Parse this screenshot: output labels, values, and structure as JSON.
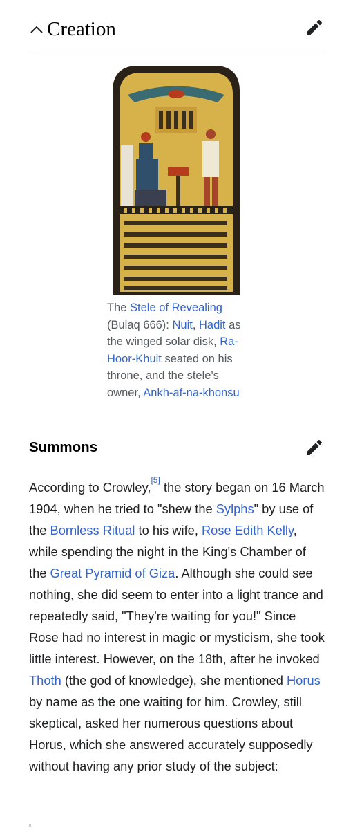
{
  "creation": {
    "title": "Creation",
    "collapse_icon": "chevron-up-icon",
    "edit_icon": "pencil-icon"
  },
  "figure": {
    "image": "stele-of-revealing-image",
    "caption": {
      "p1": "The ",
      "l1": "Stele of Revealing",
      "p2": " (Bulaq 666): ",
      "l2": "Nuit",
      "p3": ", ",
      "l3": "Hadit",
      "p4": " as the winged solar disk, ",
      "l4": "Ra-Hoor-Khuit",
      "p5": " seated on his throne, and the stele's owner, ",
      "l5": "Ankh-af-na-khonsu"
    }
  },
  "summons": {
    "title": "Summons",
    "edit_icon": "pencil-icon",
    "paragraph": {
      "t1": "According to Crowley,",
      "ref": "[5]",
      "t2": " the story began on 16 March 1904, when he tried to \"shew the ",
      "l_sylphs": "Sylphs",
      "t3": "\" by use of the ",
      "l_bornless": "Bornless Ritual",
      "t4": " to his wife, ",
      "l_rose": "Rose Edith Kelly",
      "t5": ", while spending the night in the King's Chamber of the ",
      "l_pyramid": "Great Pyramid of Giza",
      "t6": ". Although she could see nothing, she did seem to enter into a light trance and repeatedly said, \"They're waiting for you!\" Since Rose had no interest in magic or mysticism, she took little interest. However, on the 18th, after he invoked ",
      "l_thoth": "Thoth",
      "t7": " (the god of knowledge), she mentioned ",
      "l_horus": "Horus",
      "t8": " by name as the one waiting for him. Crowley, still skeptical, asked her numerous questions about Horus, which she answered accurately supposedly without having any prior study of the subject:"
    }
  },
  "colors": {
    "link": "#3366cc",
    "text": "#202122",
    "caption": "#54595d",
    "divider": "#c8ccd1",
    "icon": "#202122"
  }
}
